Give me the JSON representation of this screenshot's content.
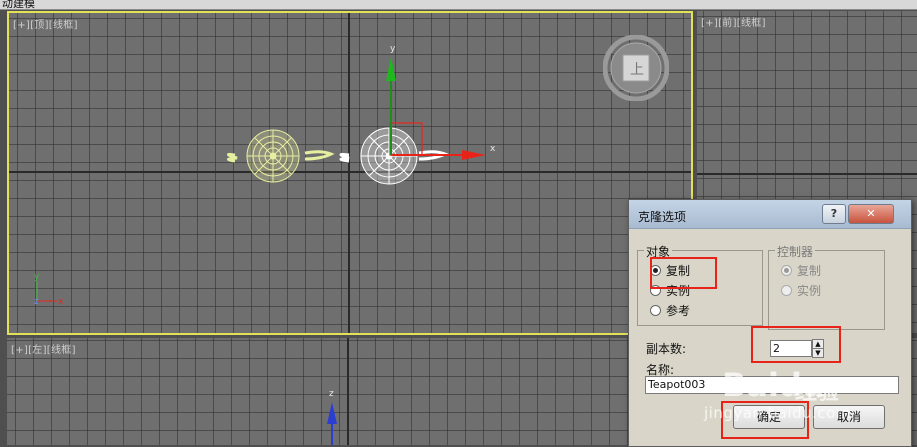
{
  "app": {
    "title_fragment": "动建模"
  },
  "viewports": {
    "top": {
      "plus": "[+]",
      "view": "[顶]",
      "shading": "[线框]"
    },
    "front": {
      "plus": "[+]",
      "view": "[前]",
      "shading": "[线框]"
    },
    "left": {
      "plus": "[+]",
      "view": "[左]",
      "shading": "[线框]"
    },
    "perspective": {
      "plus": "",
      "view": "",
      "shading": ""
    }
  },
  "gizmo": {
    "x_label": "x",
    "y_label": "y",
    "z_label": "z"
  },
  "viewcube": {
    "face_label": "上"
  },
  "axis_tripod": {
    "x": "x",
    "y": "y",
    "z": "z"
  },
  "colors": {
    "active_border": "#e3e15a",
    "selected_teapot": "#ffffff",
    "clone_teapot": "#e6eea0",
    "highlight": "#e8241a"
  },
  "dialog": {
    "title": "克隆选项",
    "help_label": "?",
    "close_label": "✕",
    "object_group": {
      "title": "对象",
      "options": [
        {
          "label": "复制",
          "selected": true
        },
        {
          "label": "实例",
          "selected": false
        },
        {
          "label": "参考",
          "selected": false
        }
      ]
    },
    "controller_group": {
      "title": "控制器",
      "options": [
        {
          "label": "复制",
          "selected": true
        },
        {
          "label": "实例",
          "selected": false
        }
      ]
    },
    "copies_label": "副本数:",
    "copies_value": "2",
    "name_label": "名称:",
    "name_value": "Teapot003",
    "ok_label": "确定",
    "cancel_label": "取消"
  },
  "watermark": {
    "logo": "Baidu",
    "text": "经验",
    "url": "jingyan.baidu.com"
  }
}
